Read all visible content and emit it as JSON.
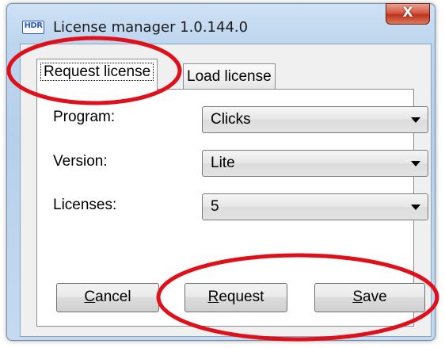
{
  "window": {
    "app_icon_text": "HDR",
    "title": "License manager 1.0.144.0",
    "close_label": "X"
  },
  "tabs": [
    {
      "label": "Request license",
      "active": true
    },
    {
      "label": "Load license",
      "active": false
    }
  ],
  "form": {
    "program": {
      "label": "Program:",
      "value": "Clicks"
    },
    "version": {
      "label": "Version:",
      "value": "Lite"
    },
    "licenses": {
      "label": "Licenses:",
      "value": "5"
    }
  },
  "buttons": {
    "cancel": {
      "mnemonic": "C",
      "rest": "ancel"
    },
    "request": {
      "mnemonic": "R",
      "rest": "equest"
    },
    "save": {
      "mnemonic": "S",
      "rest": "ave"
    }
  },
  "colors": {
    "annotation": "#e0101a",
    "close_button": "#c0321b",
    "frame": "#b7d0ea"
  },
  "icons": [
    "app-icon",
    "close-icon",
    "chevron-down-icon"
  ]
}
